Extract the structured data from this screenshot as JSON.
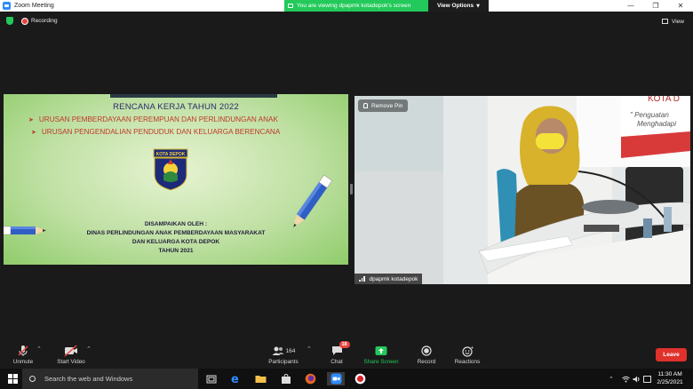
{
  "window": {
    "title": "Zoom Meeting"
  },
  "share_banner": {
    "message": "You are viewing dpapmk kotadepok's screen",
    "options_label": "View Options"
  },
  "status": {
    "recording_label": "Recording",
    "view_label": "View"
  },
  "slide": {
    "title": "RENCANA KERJA TAHUN 2022",
    "bullets": [
      "URUSAN PEMBERDAYAAN PEREMPUAN DAN PERLINDUNGAN ANAK",
      "URUSAN PENGENDALIAN PENDUDUK DAN KELUARGA BERENCANA"
    ],
    "logo_text": "KOTA DEPOK",
    "presenter_lines": [
      "DISAMPAIKAN OLEH :",
      "DINAS PERLINDUNGAN ANAK PEMBERDAYAAN MASYARAKAT",
      "DAN KELUARGA KOTA DEPOK",
      "TAHUN  2021"
    ]
  },
  "video_tile": {
    "pin_label": "Remove Pin",
    "participant_name": "dpapmk kotadepok",
    "banner_text_top": "KOTA D",
    "banner_text_mid": "\" Penguatan",
    "banner_text_low": "Menghadapi"
  },
  "toolbar": {
    "unmute_label": "Unmute",
    "start_video_label": "Start Video",
    "participants_count": "164",
    "participants_label": "Participants",
    "chat_badge": "18",
    "chat_label": "Chat",
    "share_label": "Share Screen",
    "record_label": "Record",
    "reactions_label": "Reactions",
    "leave_label": "Leave"
  },
  "taskbar": {
    "search_placeholder": "Search the web and Windows",
    "time": "11:30 AM",
    "date": "2/25/2021"
  },
  "colors": {
    "zoom_blue": "#2d8cff",
    "share_green": "#23c95a",
    "leave_red": "#e0312b",
    "slide_green": "#a9d88a"
  }
}
